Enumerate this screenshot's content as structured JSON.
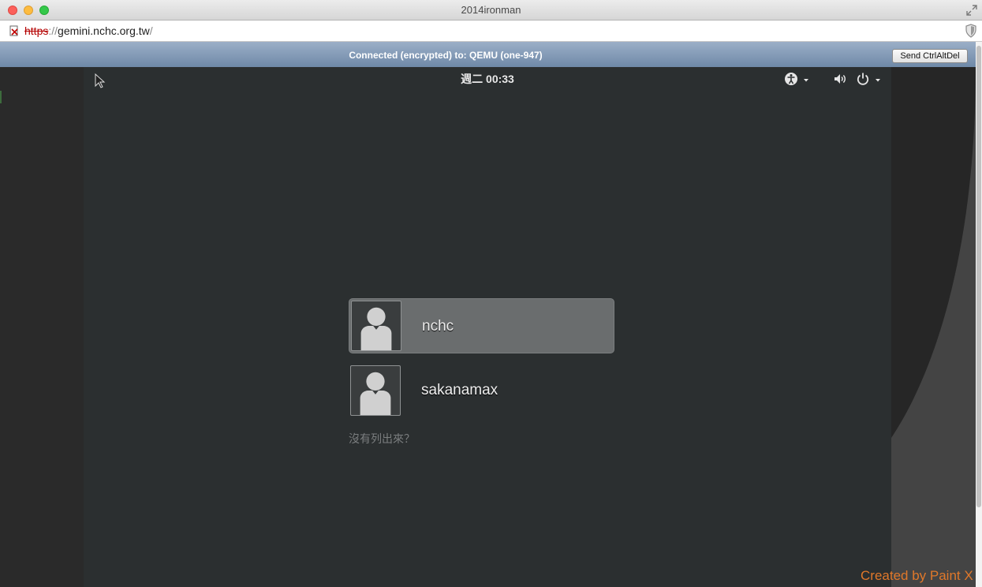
{
  "window": {
    "title": "2014ironman"
  },
  "browser": {
    "url_scheme": "https",
    "url_sep": "://",
    "url_host": "gemini.nchc.org.tw",
    "url_trail": "/"
  },
  "vnc": {
    "status": "Connected (encrypted) to: QEMU (one-947)",
    "ctrlaltdel_label": "Send CtrlAltDel"
  },
  "gdm": {
    "clock": "週二 00:33",
    "users": [
      {
        "name": "nchc",
        "selected": true
      },
      {
        "name": "sakanamax",
        "selected": false
      }
    ],
    "not_listed": "沒有列出來？"
  },
  "watermark": "Created by Paint X",
  "colors": {
    "vm_background": "#2b2f30",
    "selected_row": "#6a6d6e",
    "vnc_bar": "#7f97b4",
    "watermark": "#e0782a"
  },
  "icons": [
    "close-icon",
    "minimize-icon",
    "zoom-icon",
    "fullscreen-icon",
    "insecure-lock-icon",
    "shield-icon",
    "accessibility-icon",
    "volume-icon",
    "power-icon",
    "user-avatar-icon",
    "mouse-cursor-icon"
  ]
}
